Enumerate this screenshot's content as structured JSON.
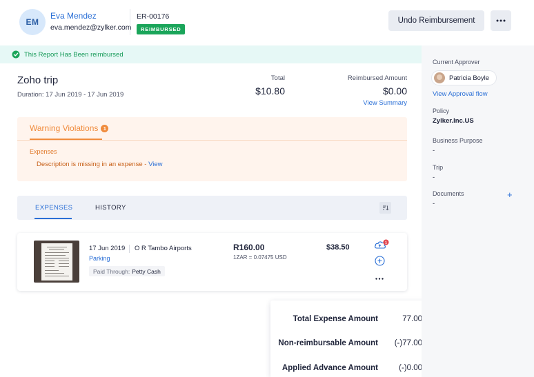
{
  "header": {
    "avatar_initials": "EM",
    "user_name": "Eva Mendez",
    "user_email": "eva.mendez@zylker.com",
    "report_id": "ER-00176",
    "status": "REIMBURSED",
    "undo_button": "Undo Reimbursement",
    "more_icon": "more-horizontal-icon"
  },
  "banner": {
    "text": "This Report Has Been reimbursed",
    "icon": "check-circle-icon"
  },
  "report": {
    "title": "Zoho trip",
    "duration": "Duration: 17 Jun 2019 - 17 Jun 2019",
    "total_label": "Total",
    "total_value": "$10.80",
    "reimbursed_label": "Reimbursed Amount",
    "reimbursed_value": "$0.00",
    "view_summary": "View Summary"
  },
  "warnings": {
    "title": "Warning Violations",
    "count": "1",
    "section": "Expenses",
    "message": "Description is missing in an expense - ",
    "view_link": "View"
  },
  "tabs": [
    {
      "label": "EXPENSES",
      "active": true
    },
    {
      "label": "HISTORY",
      "active": false
    }
  ],
  "expense": {
    "date": "17 Jun 2019",
    "merchant": "O R Tambo Airports",
    "category": "Parking",
    "paid_through_label": "Paid Through:",
    "paid_through_value": "Petty Cash",
    "foreign_amount": "R160.00",
    "exchange_rate": "1ZAR = 0.07475 USD",
    "amount": "$38.50",
    "attachment_count": "1"
  },
  "summary": {
    "rows": [
      {
        "label": "Total Expense Amount",
        "value": "77.00"
      },
      {
        "label": "Non-reimbursable Amount",
        "value": "(-)77.00"
      },
      {
        "label": "Applied Advance Amount",
        "value": "(-)0.00"
      }
    ]
  },
  "sidebar": {
    "approver_label": "Current Approver",
    "approver_name": "Patricia Boyle",
    "approval_flow_link": "View Approval flow",
    "policy_label": "Policy",
    "policy_value": "Zylker.Inc.US",
    "purpose_label": "Business Purpose",
    "purpose_value": "-",
    "trip_label": "Trip",
    "trip_value": "-",
    "documents_label": "Documents",
    "documents_value": "-",
    "add_document": "+"
  },
  "colors": {
    "accent_blue": "#2a6fd6",
    "success_green": "#1aa55a",
    "warning_orange": "#f08b3c",
    "banner_bg": "#e6f8f6",
    "warning_bg": "#fff4ed"
  }
}
